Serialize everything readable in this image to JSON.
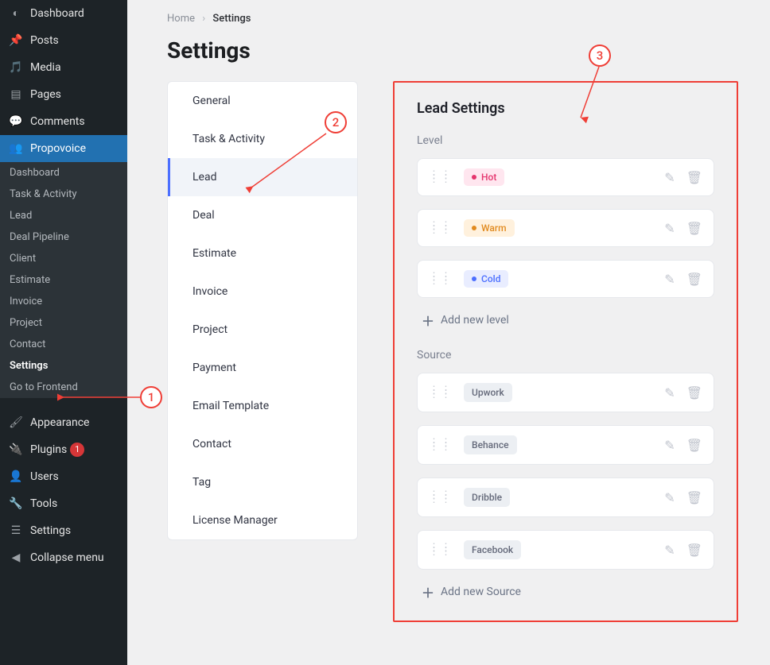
{
  "wp_sidebar": {
    "items": [
      {
        "label": "Dashboard",
        "icon": "dashboard"
      },
      {
        "label": "Posts",
        "icon": "pin"
      },
      {
        "label": "Media",
        "icon": "media"
      },
      {
        "label": "Pages",
        "icon": "pages"
      },
      {
        "label": "Comments",
        "icon": "comments"
      },
      {
        "label": "Propovoice",
        "icon": "group",
        "active": true
      },
      {
        "label": "Appearance",
        "icon": "brush"
      },
      {
        "label": "Plugins",
        "icon": "plug",
        "badge": "1"
      },
      {
        "label": "Users",
        "icon": "user"
      },
      {
        "label": "Tools",
        "icon": "wrench"
      },
      {
        "label": "Settings",
        "icon": "sliders"
      },
      {
        "label": "Collapse menu",
        "icon": "collapse"
      }
    ],
    "submenu": [
      {
        "label": "Dashboard"
      },
      {
        "label": "Task & Activity"
      },
      {
        "label": "Lead"
      },
      {
        "label": "Deal Pipeline"
      },
      {
        "label": "Client"
      },
      {
        "label": "Estimate"
      },
      {
        "label": "Invoice"
      },
      {
        "label": "Project"
      },
      {
        "label": "Contact"
      },
      {
        "label": "Settings",
        "current": true
      },
      {
        "label": "Go to Frontend"
      }
    ]
  },
  "breadcrumb": {
    "home": "Home",
    "current": "Settings",
    "sep": "›"
  },
  "page_title": "Settings",
  "settings_tabs": [
    {
      "label": "General"
    },
    {
      "label": "Task & Activity"
    },
    {
      "label": "Lead",
      "active": true
    },
    {
      "label": "Deal"
    },
    {
      "label": "Estimate"
    },
    {
      "label": "Invoice"
    },
    {
      "label": "Project"
    },
    {
      "label": "Payment"
    },
    {
      "label": "Email Template"
    },
    {
      "label": "Contact"
    },
    {
      "label": "Tag"
    },
    {
      "label": "License Manager"
    }
  ],
  "lead_settings": {
    "title": "Lead Settings",
    "sections": {
      "level": {
        "label": "Level",
        "items": [
          {
            "name": "Hot",
            "bg": "#ffe6ef",
            "fg": "#e5346d",
            "dot": "#e5346d"
          },
          {
            "name": "Warm",
            "bg": "#fff1dd",
            "fg": "#e18a1f",
            "dot": "#e18a1f"
          },
          {
            "name": "Cold",
            "bg": "#e9edff",
            "fg": "#4c6fff",
            "dot": "#4c6fff"
          }
        ],
        "add_label": "Add new level"
      },
      "source": {
        "label": "Source",
        "items": [
          {
            "name": "Upwork"
          },
          {
            "name": "Behance"
          },
          {
            "name": "Dribble"
          },
          {
            "name": "Facebook"
          }
        ],
        "add_label": "Add new Source"
      }
    }
  },
  "annotations": {
    "one": "1",
    "two": "2",
    "three": "3"
  }
}
